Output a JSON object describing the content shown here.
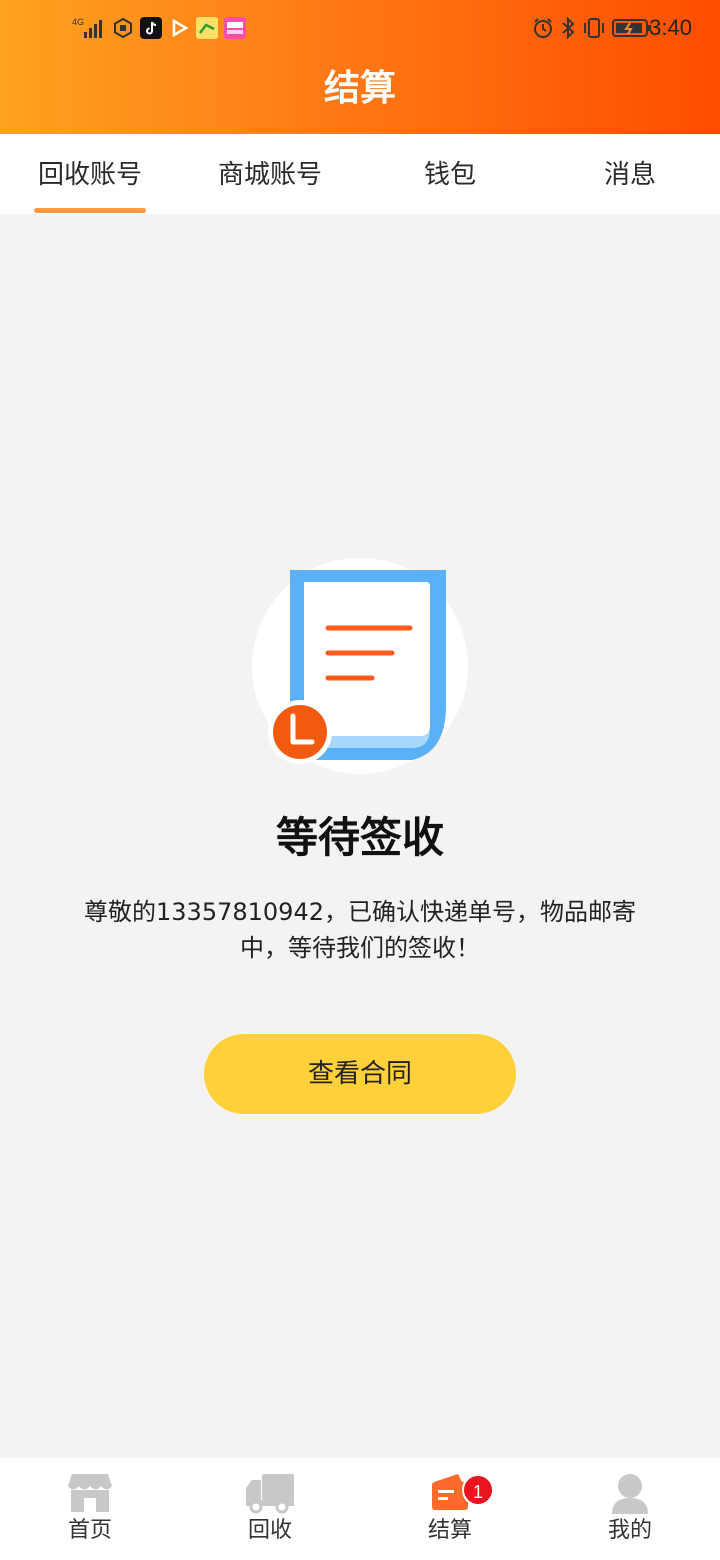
{
  "status_bar": {
    "network": "4G",
    "time": "3:40"
  },
  "header": {
    "title": "结算"
  },
  "tabs": [
    {
      "label": "回收账号",
      "active": true
    },
    {
      "label": "商城账号",
      "active": false
    },
    {
      "label": "钱包",
      "active": false
    },
    {
      "label": "消息",
      "active": false
    }
  ],
  "main": {
    "illustration_icon": "document-pending-icon",
    "status_title": "等待签收",
    "status_description": "尊敬的13357810942，已确认快递单号，物品邮寄中，等待我们的签收！",
    "contract_button_label": "查看合同"
  },
  "bottom_nav": {
    "items": [
      {
        "label": "首页",
        "icon": "store-icon",
        "active": false
      },
      {
        "label": "回收",
        "icon": "truck-icon",
        "active": false
      },
      {
        "label": "结算",
        "icon": "settlement-icon",
        "active": true,
        "badge": "1"
      },
      {
        "label": "我的",
        "icon": "user-icon",
        "active": false
      }
    ]
  },
  "colors": {
    "header_gradient_start": "#ffa220",
    "header_gradient_end": "#ff4d00",
    "tab_indicator": "#ff9944",
    "button_bg": "#ffd038",
    "badge_bg": "#e8141e",
    "nav_active": "#ff6a2c",
    "nav_inactive": "#cccccc"
  }
}
